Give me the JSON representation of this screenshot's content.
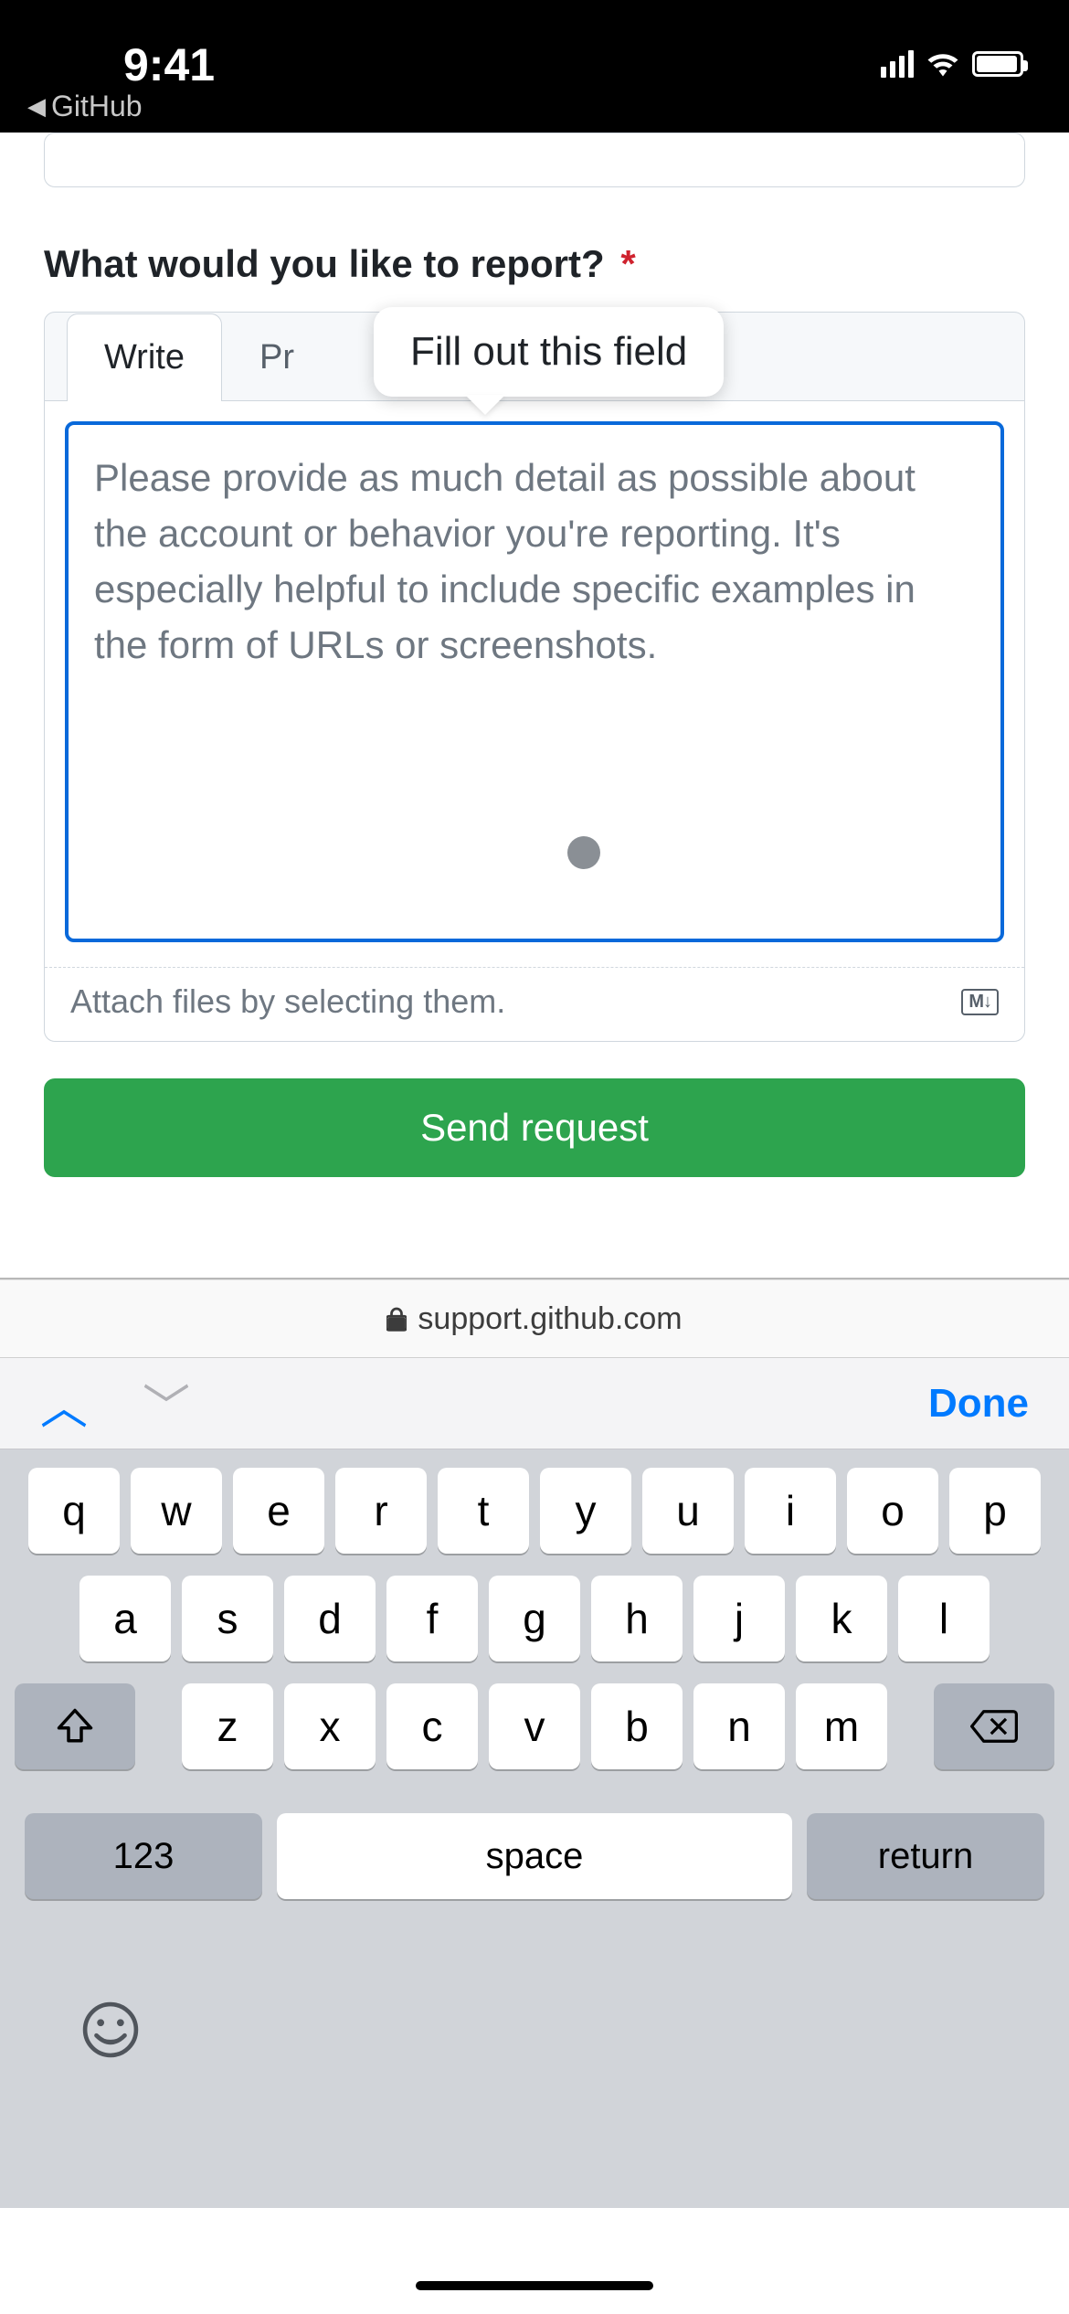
{
  "status": {
    "time": "9:41",
    "back_app": "GitHub"
  },
  "form": {
    "label": "What would you like to report?",
    "required_marker": "*",
    "tabs": {
      "write": "Write",
      "preview_truncated": "Pr"
    },
    "tooltip": "Fill out this field",
    "textarea_value": "",
    "textarea_placeholder": "Please provide as much detail as possible about the account or behavior you're reporting. It's especially helpful to include specific examples in the form of URLs or screenshots.",
    "attach_hint": "Attach files by selecting them.",
    "markdown_badge": "M↓",
    "submit": "Send request"
  },
  "browser": {
    "domain": "support.github.com"
  },
  "kb_accessory": {
    "done": "Done"
  },
  "keyboard": {
    "row1": [
      "q",
      "w",
      "e",
      "r",
      "t",
      "y",
      "u",
      "i",
      "o",
      "p"
    ],
    "row2": [
      "a",
      "s",
      "d",
      "f",
      "g",
      "h",
      "j",
      "k",
      "l"
    ],
    "row3": [
      "z",
      "x",
      "c",
      "v",
      "b",
      "n",
      "m"
    ],
    "numbers": "123",
    "space": "space",
    "ret": "return"
  }
}
